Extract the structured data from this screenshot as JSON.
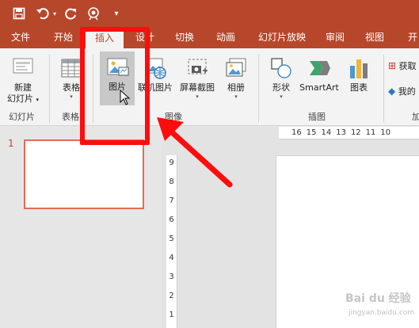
{
  "quick_access": {
    "items": [
      {
        "name": "save-icon"
      },
      {
        "name": "undo-icon"
      },
      {
        "name": "redo-icon"
      },
      {
        "name": "present-from-start-icon"
      },
      {
        "name": "customize-qat-icon"
      }
    ]
  },
  "tabs": [
    {
      "label": "文件",
      "active": false
    },
    {
      "label": "开始",
      "active": false
    },
    {
      "label": "插入",
      "active": true
    },
    {
      "label": "设计",
      "active": false
    },
    {
      "label": "切换",
      "active": false
    },
    {
      "label": "动画",
      "active": false
    },
    {
      "label": "幻灯片放映",
      "active": false
    },
    {
      "label": "审阅",
      "active": false
    },
    {
      "label": "视图",
      "active": false
    },
    {
      "label": "开",
      "active": false
    }
  ],
  "ribbon": {
    "new_slide": {
      "line1": "新建",
      "line2": "幻灯片"
    },
    "table": {
      "label": "表格"
    },
    "picture": {
      "label": "图片"
    },
    "online_picture": {
      "label": "联机图片"
    },
    "screenshot": {
      "label": "屏幕截图"
    },
    "album": {
      "label": "相册"
    },
    "shapes": {
      "label": "形状"
    },
    "smartart": {
      "label": "SmartArt"
    },
    "chart": {
      "label": "图表"
    },
    "get_addins": {
      "label": "获取"
    },
    "my_addins": {
      "label": "我的"
    },
    "groups": {
      "slides": "幻灯片",
      "tables": "表格",
      "images": "图像",
      "illustrations": "插图",
      "addins": "加"
    }
  },
  "slides_pane": {
    "slide_number": "1"
  },
  "ruler": {
    "h_ticks": [
      "16",
      "15",
      "14",
      "13",
      "12",
      "11",
      "10"
    ],
    "v_ticks": [
      "9",
      "8",
      "7",
      "6",
      "5",
      "4",
      "3",
      "2",
      "1"
    ]
  },
  "colors": {
    "accent": "#b7472a",
    "annotation_red": "#ff0c0c",
    "thumbnail_border": "#e46c51"
  },
  "watermark": {
    "text": "Bai du 经验",
    "sub": "jingyan.baidu.com"
  }
}
